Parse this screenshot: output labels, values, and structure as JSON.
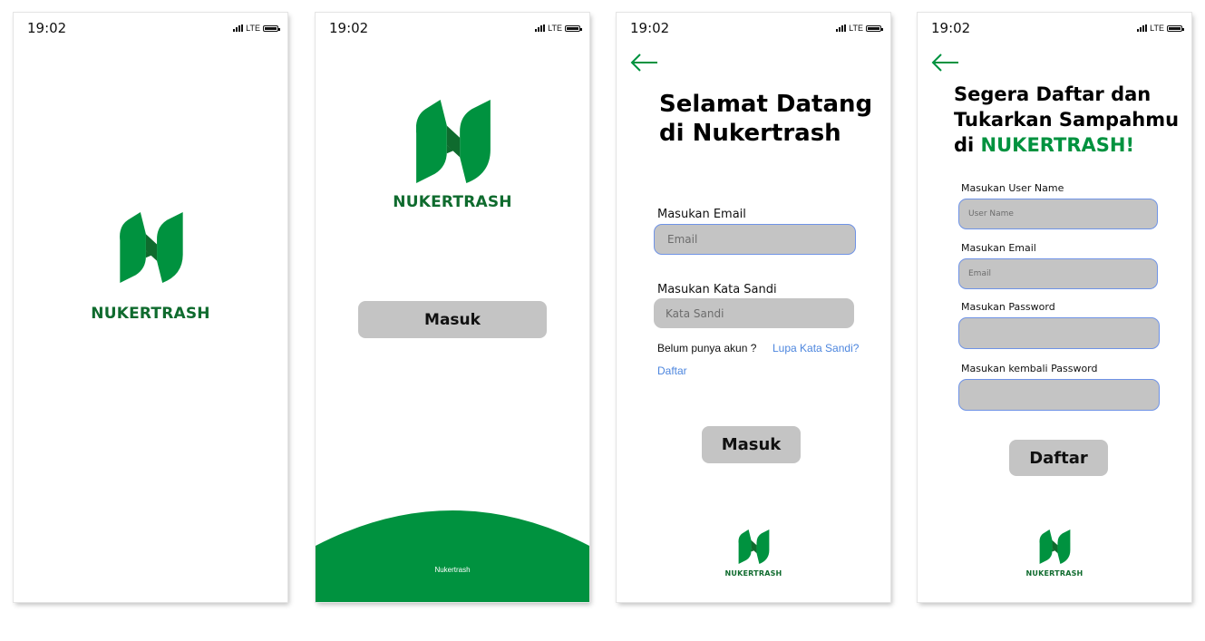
{
  "status_bar": {
    "time": "19:02",
    "network": "LTE"
  },
  "colors": {
    "brand_green": "#00923f",
    "brand_dark_green": "#0f6b2e",
    "button_gray": "#c4c4c4",
    "link_blue": "#4d86de",
    "input_border": "#6f93e6"
  },
  "screen1": {
    "brand": "NUKERTRASH"
  },
  "screen2": {
    "brand": "NUKERTRASH",
    "login_button": "Masuk",
    "footer_text": "Nukertrash"
  },
  "screen3": {
    "title_line1": "Selamat Datang",
    "title_line2": "di Nukertrash",
    "email_label": "Masukan Email",
    "email_placeholder": "Email",
    "password_label": "Masukan Kata Sandi",
    "password_placeholder": "Kata Sandi",
    "no_account_text": "Belum punya akun ?",
    "forgot_link": "Lupa Kata Sandi?",
    "register_link": "Daftar",
    "login_button": "Masuk",
    "brand": "NUKERTRASH"
  },
  "screen4": {
    "title_line1": "Segera Daftar dan",
    "title_line2": "Tukarkan Sampahmu",
    "title_line3_prefix": "di ",
    "title_line3_brand": "NUKERTRASH!",
    "username_label": "Masukan User Name",
    "username_placeholder": "User Name",
    "email_label": "Masukan Email",
    "email_placeholder": "Email",
    "password_label": "Masukan Password",
    "password_placeholder": "",
    "confirm_label": "Masukan kembali Password",
    "confirm_placeholder": "",
    "register_button": "Daftar",
    "brand": "NUKERTRASH"
  }
}
